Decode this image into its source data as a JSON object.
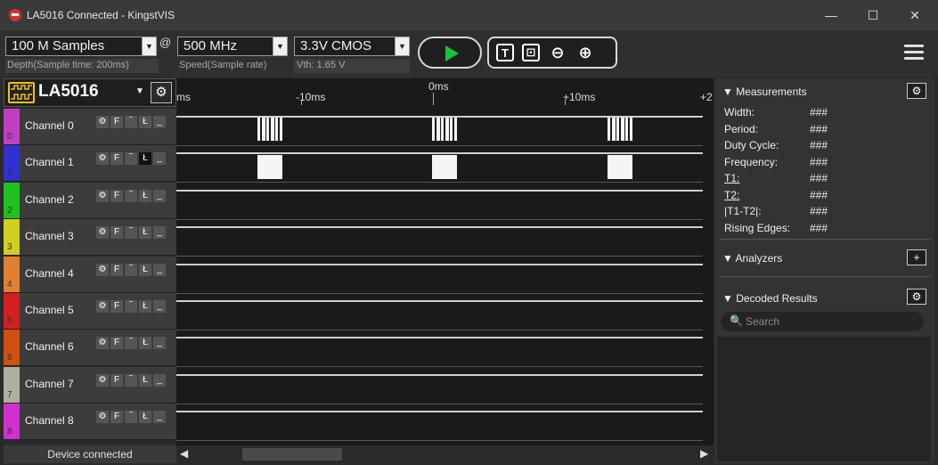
{
  "window": {
    "title": "LA5016 Connected - KingstVIS",
    "minimize_icon": "—",
    "maximize_icon": "☐",
    "close_icon": "✕"
  },
  "toolbar": {
    "depth": {
      "value": "100 M Samples",
      "caption": "Depth(Sample time: 200ms)"
    },
    "at_symbol": "@",
    "speed": {
      "value": "500 MHz",
      "caption": "Speed(Sample rate)"
    },
    "logic": {
      "value": "3.3V CMOS",
      "caption": "Vth: 1.65 V"
    },
    "tool_icons": [
      "T",
      "⊡",
      "⊖",
      "⊕"
    ]
  },
  "device": {
    "name": "LA5016",
    "caret": "▼"
  },
  "channels": [
    {
      "name": "Channel 0",
      "num": "0",
      "color": "#c040c0"
    },
    {
      "name": "Channel 1",
      "num": "1",
      "color": "#3030d0"
    },
    {
      "name": "Channel 2",
      "num": "2",
      "color": "#20c020"
    },
    {
      "name": "Channel 3",
      "num": "3",
      "color": "#d0d020"
    },
    {
      "name": "Channel 4",
      "num": "4",
      "color": "#e08030"
    },
    {
      "name": "Channel 5",
      "num": "5",
      "color": "#d02020"
    },
    {
      "name": "Channel 6",
      "num": "6",
      "color": "#d05010"
    },
    {
      "name": "Channel 7",
      "num": "7",
      "color": "#b0b0a0"
    },
    {
      "name": "Channel 8",
      "num": "8",
      "color": "#d030d0"
    }
  ],
  "channel_ctrls": [
    "⚙",
    "F",
    "‾",
    "Ł",
    "_"
  ],
  "status": {
    "text": "Device connected"
  },
  "ruler": {
    "left_cut": "ms",
    "m10": "-10ms",
    "zero": "0ms",
    "p10": "+10ms",
    "right_cut": "+2"
  },
  "scroll": {
    "left": "◀",
    "right": "▶"
  },
  "measurements": {
    "header": "▼ Measurements",
    "rows": [
      {
        "label": "Width:",
        "value": "###"
      },
      {
        "label": "Period:",
        "value": "###"
      },
      {
        "label": "Duty Cycle:",
        "value": "###"
      },
      {
        "label": "Frequency:",
        "value": "###"
      },
      {
        "label": "T1:",
        "value": "###"
      },
      {
        "label": "T2:",
        "value": "###"
      },
      {
        "label": "|T1-T2|:",
        "value": "###"
      },
      {
        "label": "Rising Edges:",
        "value": "###"
      }
    ]
  },
  "analyzers": {
    "header": "▼ Analyzers",
    "add": "+"
  },
  "decoded": {
    "header": "▼ Decoded Results",
    "search_icon": "🔍",
    "search_placeholder": "Search"
  },
  "gear": "⚙",
  "accent": {
    "run": "#16c240",
    "logo": "#f0c020"
  }
}
